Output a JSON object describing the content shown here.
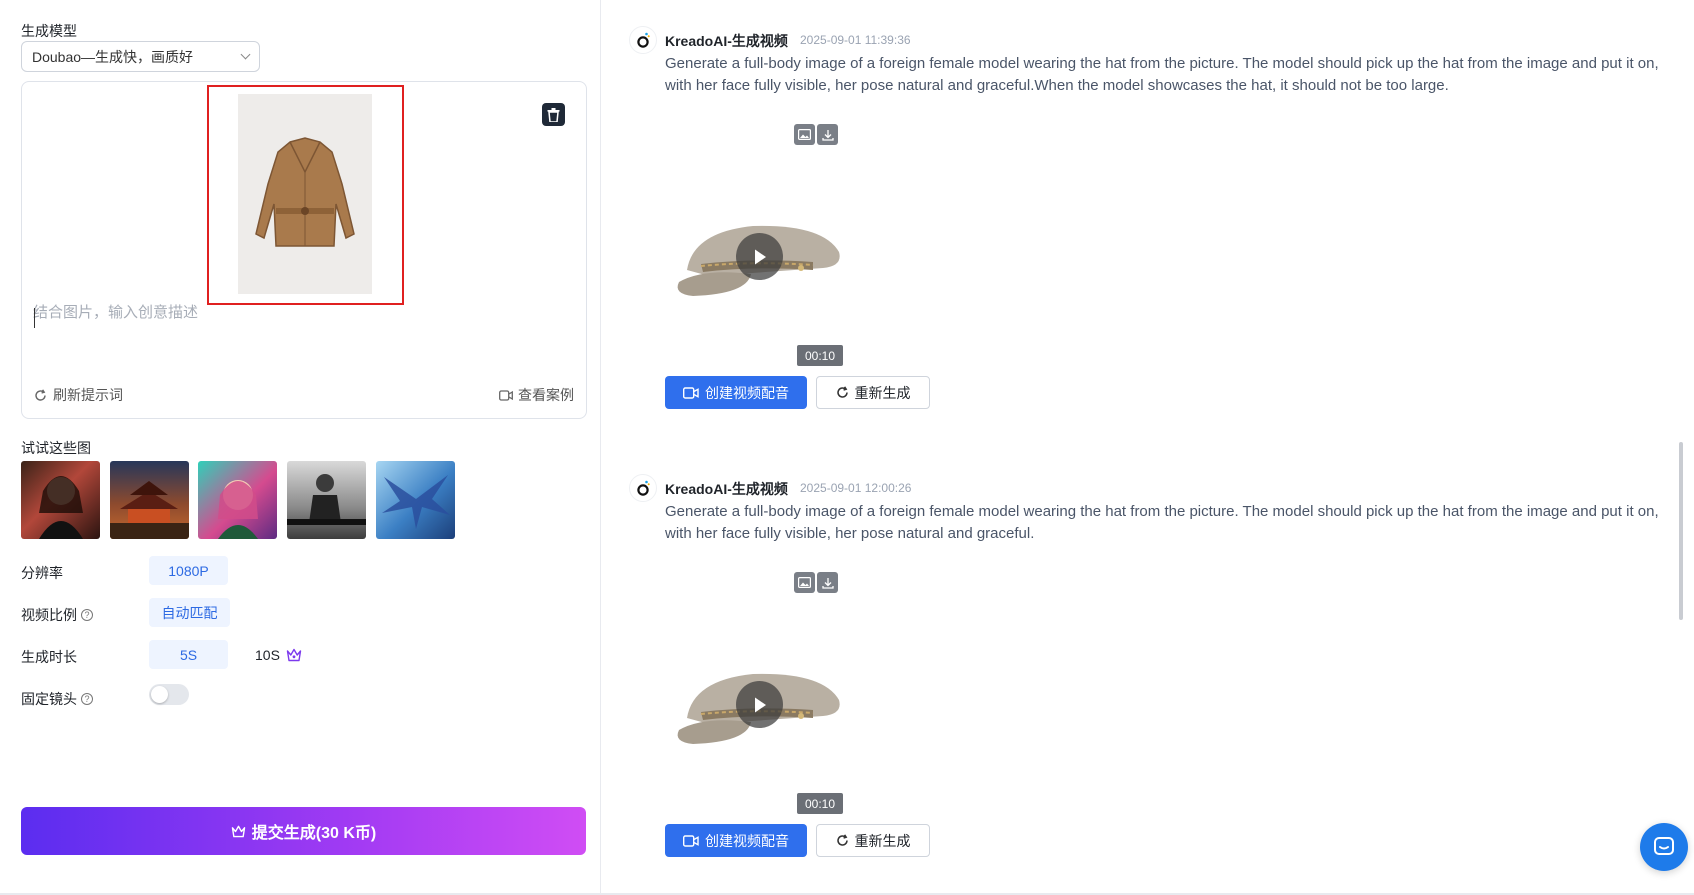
{
  "left_panel": {
    "model_label": "生成模型",
    "model_value": "Doubao—生成快，画质好",
    "prompt_placeholder": "结合图片，输入创意描述",
    "refresh_label": "刷新提示词",
    "cases_label": "查看案例",
    "try_label": "试试这些图",
    "resolution_label": "分辨率",
    "resolution_value": "1080P",
    "ratio_label": "视频比例",
    "ratio_value": "自动匹配",
    "duration_label": "生成时长",
    "duration_option_1": "5S",
    "duration_option_2": "10S",
    "fixed_lens_label": "固定镜头",
    "fixed_lens_on": false,
    "submit_label": "提交生成(30 K币)"
  },
  "feed": {
    "messages": [
      {
        "sender": "KreadoAI-生成视频",
        "time": "2025-09-01 11:39:36",
        "text": "Generate a full-body image of a foreign female model wearing the hat from the picture. The model should pick up the hat from the image and put it on, with her face fully visible, her pose natural and graceful.When the model showcases the hat, it should not be too large.",
        "duration": "00:10",
        "create_audio_label": "创建视频配音",
        "regenerate_label": "重新生成"
      },
      {
        "sender": "KreadoAI-生成视频",
        "time": "2025-09-01 12:00:26",
        "text": "Generate a full-body image of a foreign female model wearing the hat from the picture. The model should pick up the hat from the image and put it on, with her face fully visible, her pose natural and graceful.",
        "duration": "00:10",
        "create_audio_label": "创建视频配音",
        "regenerate_label": "重新生成"
      }
    ]
  },
  "colors": {
    "accent_blue": "#2f6fed",
    "submit_gradient_start": "#5b2df0",
    "submit_gradient_end": "#d04df4",
    "highlight_red": "#e02020"
  }
}
